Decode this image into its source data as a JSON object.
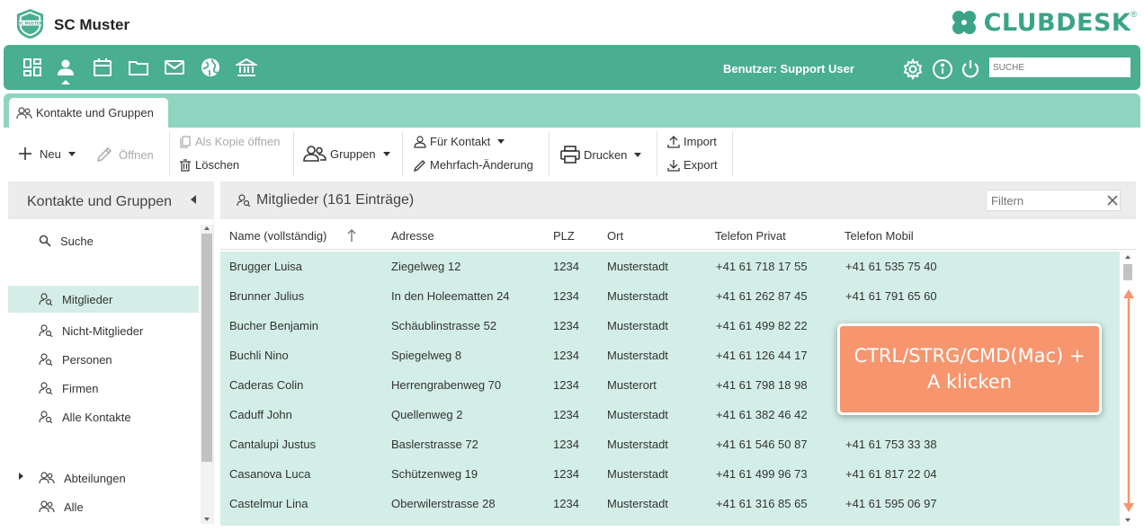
{
  "header": {
    "club_name": "SC Muster",
    "logo_text": "SC MUSTER",
    "brand": "CLUBDESK",
    "brand_mark": "®"
  },
  "navbar": {
    "user_label": "Benutzer: Support User",
    "search_placeholder": "SUCHE",
    "icons": [
      "dashboard-icon",
      "person-icon",
      "calendar-icon",
      "folder-icon",
      "mail-icon",
      "globe-icon",
      "bank-icon"
    ]
  },
  "tabs": [
    {
      "label": "Kontakte und Gruppen",
      "active": true
    }
  ],
  "toolbar": {
    "neu": "Neu",
    "oeffnen": "Öffnen",
    "als_kopie": "Als Kopie öffnen",
    "loeschen": "Löschen",
    "gruppen": "Gruppen",
    "fuer_kontakt": "Für Kontakt",
    "mehrfach": "Mehrfach-Änderung",
    "drucken": "Drucken",
    "import": "Import",
    "export": "Export"
  },
  "leftpanel": {
    "title": "Kontakte und Gruppen",
    "items": [
      {
        "label": "Suche"
      },
      {
        "label": "Mitglieder",
        "active": true
      },
      {
        "label": "Nicht-Mitglieder"
      },
      {
        "label": "Personen"
      },
      {
        "label": "Firmen"
      },
      {
        "label": "Alle Kontakte"
      },
      {
        "label": "Abteilungen"
      },
      {
        "label": "Alle"
      }
    ]
  },
  "mainpanel": {
    "title": "Mitglieder (161 Einträge)",
    "filter_placeholder": "Filtern",
    "columns": [
      "Name (vollständig)",
      "Adresse",
      "PLZ",
      "Ort",
      "Telefon Privat",
      "Telefon Mobil"
    ],
    "rows": [
      [
        "Brugger Luisa",
        "Ziegelweg 12",
        "1234",
        "Musterstadt",
        "+41 61 718 17 55",
        "+41 61 535 75 40"
      ],
      [
        "Brunner Julius",
        "In den Holeematten 24",
        "1234",
        "Musterstadt",
        "+41 61 262 87 45",
        "+41 61 791 65 60"
      ],
      [
        "Bucher Benjamin",
        "Schäublinstrasse 52",
        "1234",
        "Musterstadt",
        "+41 61 499 82 22",
        ""
      ],
      [
        "Buchli Nino",
        "Spiegelweg 8",
        "1234",
        "Musterstadt",
        "+41 61 126 44 17",
        ""
      ],
      [
        "Caderas Colin",
        "Herrengrabenweg 70",
        "1234",
        "Musterort",
        "+41 61 798 18 98",
        ""
      ],
      [
        "Caduff John",
        "Quellenweg 2",
        "1234",
        "Musterstadt",
        "+41 61 382 46 42",
        ""
      ],
      [
        "Cantalupi Justus",
        "Baslerstrasse 72",
        "1234",
        "Musterstadt",
        "+41 61 546 50 87",
        "+41 61 753 33 38"
      ],
      [
        "Casanova Luca",
        "Schützenweg 19",
        "1234",
        "Musterstadt",
        "+41 61 499 96 73",
        "+41 61 817 22 04"
      ],
      [
        "Castelmur Lina",
        "Oberwilerstrasse 28",
        "1234",
        "Musterstadt",
        "+41 61 316 85 65",
        "+41 61 595 06 97"
      ]
    ]
  },
  "callout": {
    "line1": "CTRL/STRG/CMD(Mac) +",
    "line2": "A klicken"
  },
  "colors": {
    "accent": "#4aae90",
    "tabstrip": "#8ed5c0",
    "selected_row": "#d3eee7",
    "callout": "#f7956e"
  }
}
